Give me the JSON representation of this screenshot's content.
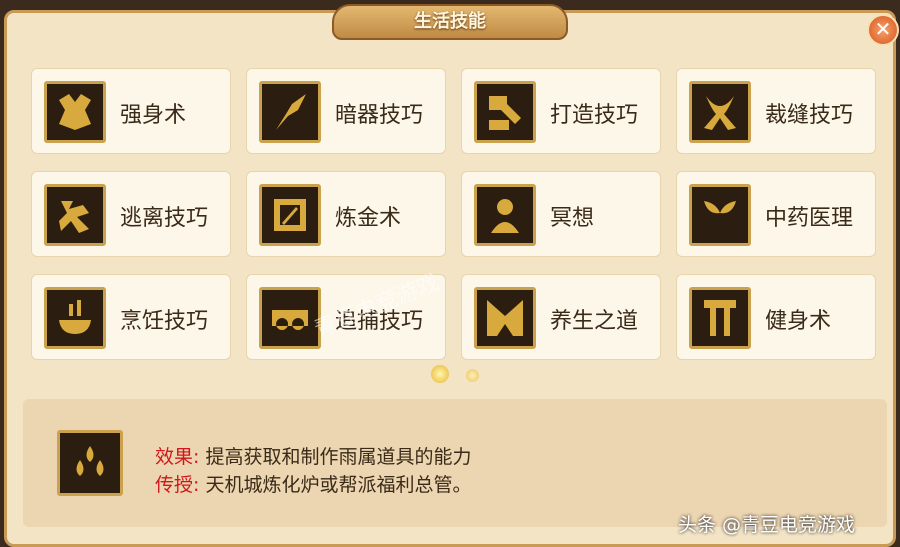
{
  "window": {
    "title": "生活技能",
    "close_icon": "close-icon"
  },
  "colors": {
    "panel_bg": "#f3e4c5",
    "gold_border": "#caa24d",
    "accent_red": "#d0171c"
  },
  "skills": [
    {
      "label": "强身术",
      "icon": "strength-icon"
    },
    {
      "label": "暗器技巧",
      "icon": "dart-icon"
    },
    {
      "label": "打造技巧",
      "icon": "hammer-icon"
    },
    {
      "label": "裁缝技巧",
      "icon": "scissors-icon"
    },
    {
      "label": "逃离技巧",
      "icon": "escape-icon"
    },
    {
      "label": "炼金术",
      "icon": "alchemy-icon"
    },
    {
      "label": "冥想",
      "icon": "meditation-icon"
    },
    {
      "label": "中药医理",
      "icon": "herb-icon"
    },
    {
      "label": "烹饪技巧",
      "icon": "cooking-icon"
    },
    {
      "label": "追捕技巧",
      "icon": "pursuit-icon"
    },
    {
      "label": "养生之道",
      "icon": "wellness-icon"
    },
    {
      "label": "健身术",
      "icon": "fitness-icon"
    }
  ],
  "pagination": {
    "pages": 2,
    "current": 1
  },
  "detail": {
    "icon": "water-drops-icon",
    "effect_key": "效果:",
    "effect_value": "提高获取和制作雨属道具的能力",
    "teach_key": "传授:",
    "teach_value": "天机城炼化炉或帮派福利总管。"
  },
  "watermark": "青豆电竞游戏",
  "footer_credit": "头条 @青豆电竞游戏"
}
